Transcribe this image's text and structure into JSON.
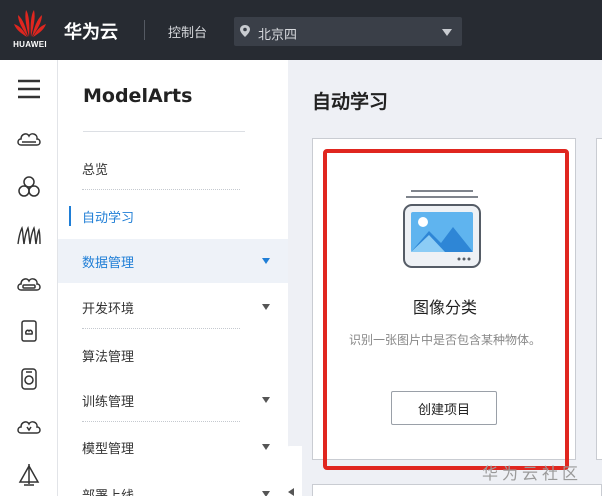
{
  "topbar": {
    "logo_text": "HUAWEI",
    "brand": "华为云",
    "console_label": "控制台",
    "region": {
      "selected": "北京四"
    },
    "colors": {
      "background": "#272b32",
      "logo_red": "#e0261f"
    }
  },
  "rail": {
    "icons": [
      "menu-icon",
      "cloud-icon",
      "cluster-icon",
      "grass-icon",
      "disk-cloud-icon",
      "device-icon",
      "phone-icon",
      "cloud-down-icon",
      "sail-icon"
    ]
  },
  "subnav": {
    "title": "ModelArts",
    "items": [
      {
        "label": "总览",
        "has_caret": false,
        "active": false
      },
      {
        "label": "自动学习",
        "has_caret": false,
        "active": true
      },
      {
        "label": "数据管理",
        "has_caret": true,
        "active": false,
        "hover": true
      },
      {
        "label": "开发环境",
        "has_caret": true,
        "active": false
      },
      {
        "label": "算法管理",
        "has_caret": false,
        "active": false
      },
      {
        "label": "训练管理",
        "has_caret": true,
        "active": false
      },
      {
        "label": "模型管理",
        "has_caret": true,
        "active": false
      },
      {
        "label": "部署上线",
        "has_caret": true,
        "active": false
      }
    ],
    "accent_color": "#1f7ed6"
  },
  "main": {
    "page_title": "自动学习",
    "card": {
      "title": "图像分类",
      "description": "识别一张图片中是否包含某种物体。",
      "button_label": "创建项目",
      "icon": "image-classification-icon",
      "highlight_color": "#e0261f"
    }
  },
  "watermark": "华为云社区"
}
